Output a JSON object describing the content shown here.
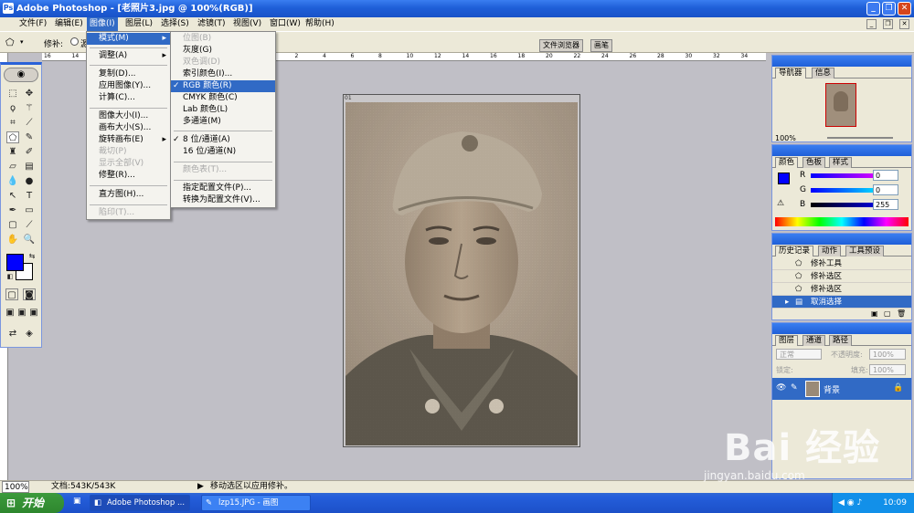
{
  "window": {
    "title": "Adobe Photoshop - [老照片3.jpg @ 100%(RGB)]"
  },
  "menubar": {
    "items": [
      "文件(F)",
      "编辑(E)",
      "图像(I)",
      "图层(L)",
      "选择(S)",
      "滤镜(T)",
      "视图(V)",
      "窗口(W)",
      "帮助(H)"
    ]
  },
  "options": {
    "label": "修补:",
    "radio_fragment": "源"
  },
  "optbar_tabs": {
    "file_browser": "文件浏览器",
    "brushes": "画笔"
  },
  "image_menu": {
    "items": [
      {
        "label": "模式(M)",
        "submenu": true,
        "selected": true,
        "disabled": false
      },
      {
        "label": "调整(A)",
        "submenu": true,
        "selected": false,
        "disabled": false
      },
      {
        "label": "复制(D)...",
        "submenu": false,
        "selected": false,
        "disabled": false
      },
      {
        "label": "应用图像(Y)...",
        "submenu": false,
        "selected": false,
        "disabled": false
      },
      {
        "label": "计算(C)...",
        "submenu": false,
        "selected": false,
        "disabled": false
      },
      {
        "label": "图像大小(I)...",
        "submenu": false,
        "selected": false,
        "disabled": false
      },
      {
        "label": "画布大小(S)...",
        "submenu": false,
        "selected": false,
        "disabled": false
      },
      {
        "label": "旋转画布(E)",
        "submenu": true,
        "selected": false,
        "disabled": false
      },
      {
        "label": "裁切(P)",
        "submenu": false,
        "selected": false,
        "disabled": true
      },
      {
        "label": "显示全部(V)",
        "submenu": false,
        "selected": false,
        "disabled": true
      },
      {
        "label": "修整(R)...",
        "submenu": false,
        "selected": false,
        "disabled": false
      },
      {
        "label": "直方图(H)...",
        "submenu": false,
        "selected": false,
        "disabled": false
      },
      {
        "label": "陷印(T)...",
        "submenu": false,
        "selected": false,
        "disabled": true
      }
    ]
  },
  "mode_menu": {
    "items": [
      {
        "label": "位图(B)",
        "disabled": true,
        "checked": false,
        "selected": false
      },
      {
        "label": "灰度(G)",
        "disabled": false,
        "checked": false,
        "selected": false
      },
      {
        "label": "双色调(D)",
        "disabled": true,
        "checked": false,
        "selected": false
      },
      {
        "label": "索引颜色(I)...",
        "disabled": false,
        "checked": false,
        "selected": false
      },
      {
        "label": "RGB 颜色(R)",
        "disabled": false,
        "checked": true,
        "selected": true
      },
      {
        "label": "CMYK 颜色(C)",
        "disabled": false,
        "checked": false,
        "selected": false
      },
      {
        "label": "Lab 颜色(L)",
        "disabled": false,
        "checked": false,
        "selected": false
      },
      {
        "label": "多通道(M)",
        "disabled": false,
        "checked": false,
        "selected": false
      },
      {
        "label": "8 位/通道(A)",
        "disabled": false,
        "checked": true,
        "selected": false
      },
      {
        "label": "16 位/通道(N)",
        "disabled": false,
        "checked": false,
        "selected": false
      },
      {
        "label": "颜色表(T)...",
        "disabled": true,
        "checked": false,
        "selected": false
      },
      {
        "label": "指定配置文件(P)...",
        "disabled": false,
        "checked": false,
        "selected": false
      },
      {
        "label": "转换为配置文件(V)...",
        "disabled": false,
        "checked": false,
        "selected": false
      }
    ]
  },
  "ruler": {
    "top_labels": [
      "16",
      "14",
      "12",
      "10",
      "8",
      "6",
      "4",
      "2",
      "0",
      "2",
      "4",
      "6",
      "8",
      "10",
      "12",
      "14",
      "16",
      "18",
      "20",
      "22",
      "24",
      "26",
      "28",
      "30",
      "32",
      "34"
    ]
  },
  "document": {
    "label": "01"
  },
  "navigator": {
    "tabs": [
      "导航器",
      "信息"
    ],
    "zoom": "100%"
  },
  "color_panel": {
    "tabs": [
      "颜色",
      "色板",
      "样式"
    ],
    "channels": [
      {
        "name": "R",
        "value": "0"
      },
      {
        "name": "G",
        "value": "0"
      },
      {
        "name": "B",
        "value": "255"
      }
    ],
    "foreground": "#0000ff"
  },
  "history_panel": {
    "tabs": [
      "历史记录",
      "动作",
      "工具预设"
    ],
    "items": [
      "修补工具",
      "修补选区",
      "修补选区",
      "取消选择"
    ]
  },
  "layers_panel": {
    "tabs": [
      "图层",
      "通道",
      "路径"
    ],
    "blend_mode": "正常",
    "opacity_label": "不透明度:",
    "opacity": "100%",
    "lock_label": "锁定:",
    "fill_label": "填充:",
    "fill": "100%",
    "layer_name": "背景"
  },
  "statusbar": {
    "zoom": "100%",
    "doc_size": "文档:543K/543K",
    "message": "移动选区以应用修补。"
  },
  "taskbar": {
    "start": "开始",
    "tasks": [
      "Adobe Photoshop ...",
      "lzp15.JPG - 画图"
    ],
    "time": "10:09"
  },
  "watermark": {
    "brand": "Bai  经验",
    "url": "jingyan.baidu.com"
  }
}
